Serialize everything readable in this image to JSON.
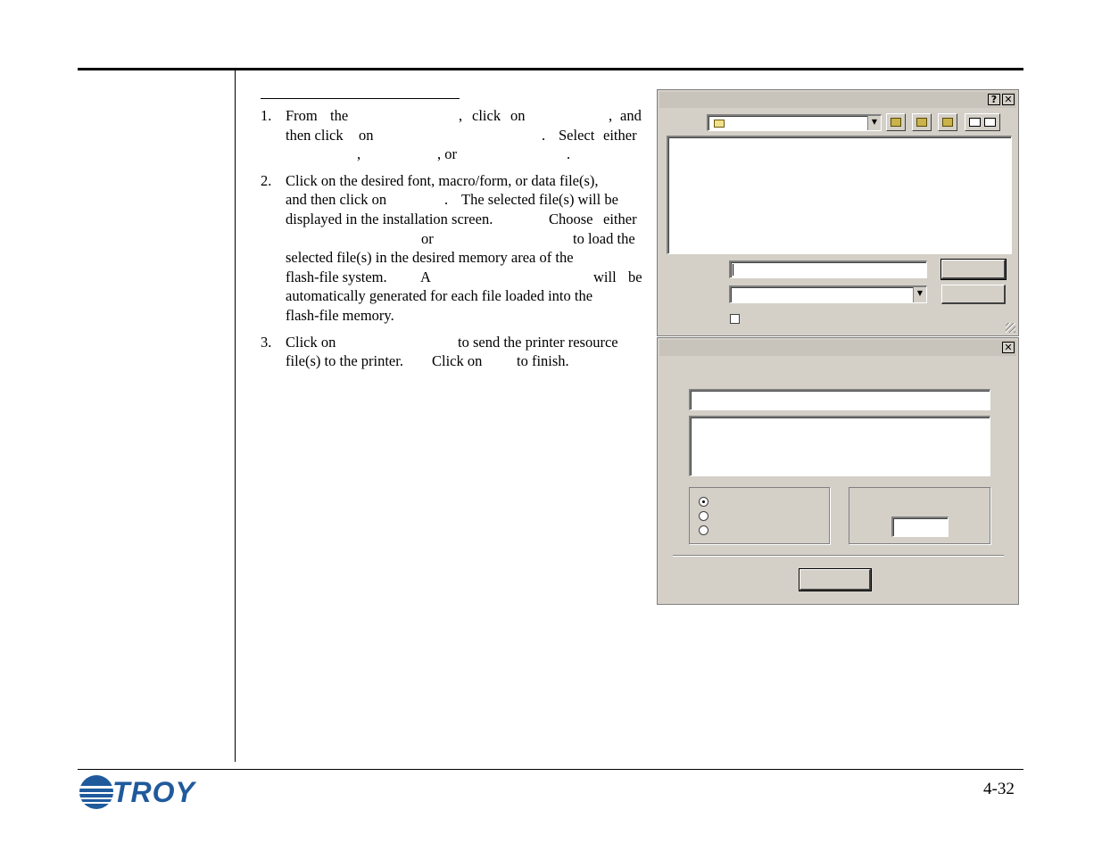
{
  "page_number": "4-32",
  "logo_text": "TROY",
  "steps": [
    {
      "number": "1.",
      "lines": [
        [
          "From",
          "the",
          ",",
          "click",
          "on",
          ",",
          "and"
        ],
        [
          "then click",
          "on",
          ".",
          "Select",
          "either"
        ],
        [
          ",",
          ", or",
          "."
        ]
      ]
    },
    {
      "number": "2.",
      "lines": [
        [
          "Click on the desired font, macro/form, or data file(s),"
        ],
        [
          "and then click on",
          ".",
          "The selected file(s) will be"
        ],
        [
          "displayed in the installation screen.",
          "Choose",
          "either"
        ],
        [
          "or",
          "to load the"
        ],
        [
          "selected file(s) in the desired memory area of the"
        ],
        [
          "flash-file system.",
          "A",
          "will",
          "be"
        ],
        [
          "automatically generated for each file loaded into the"
        ],
        [
          "flash-file memory."
        ]
      ]
    },
    {
      "number": "3.",
      "lines": [
        [
          "Click on",
          "to send the printer resource"
        ],
        [
          "file(s) to the printer.",
          "Click on",
          "to finish."
        ]
      ]
    }
  ]
}
